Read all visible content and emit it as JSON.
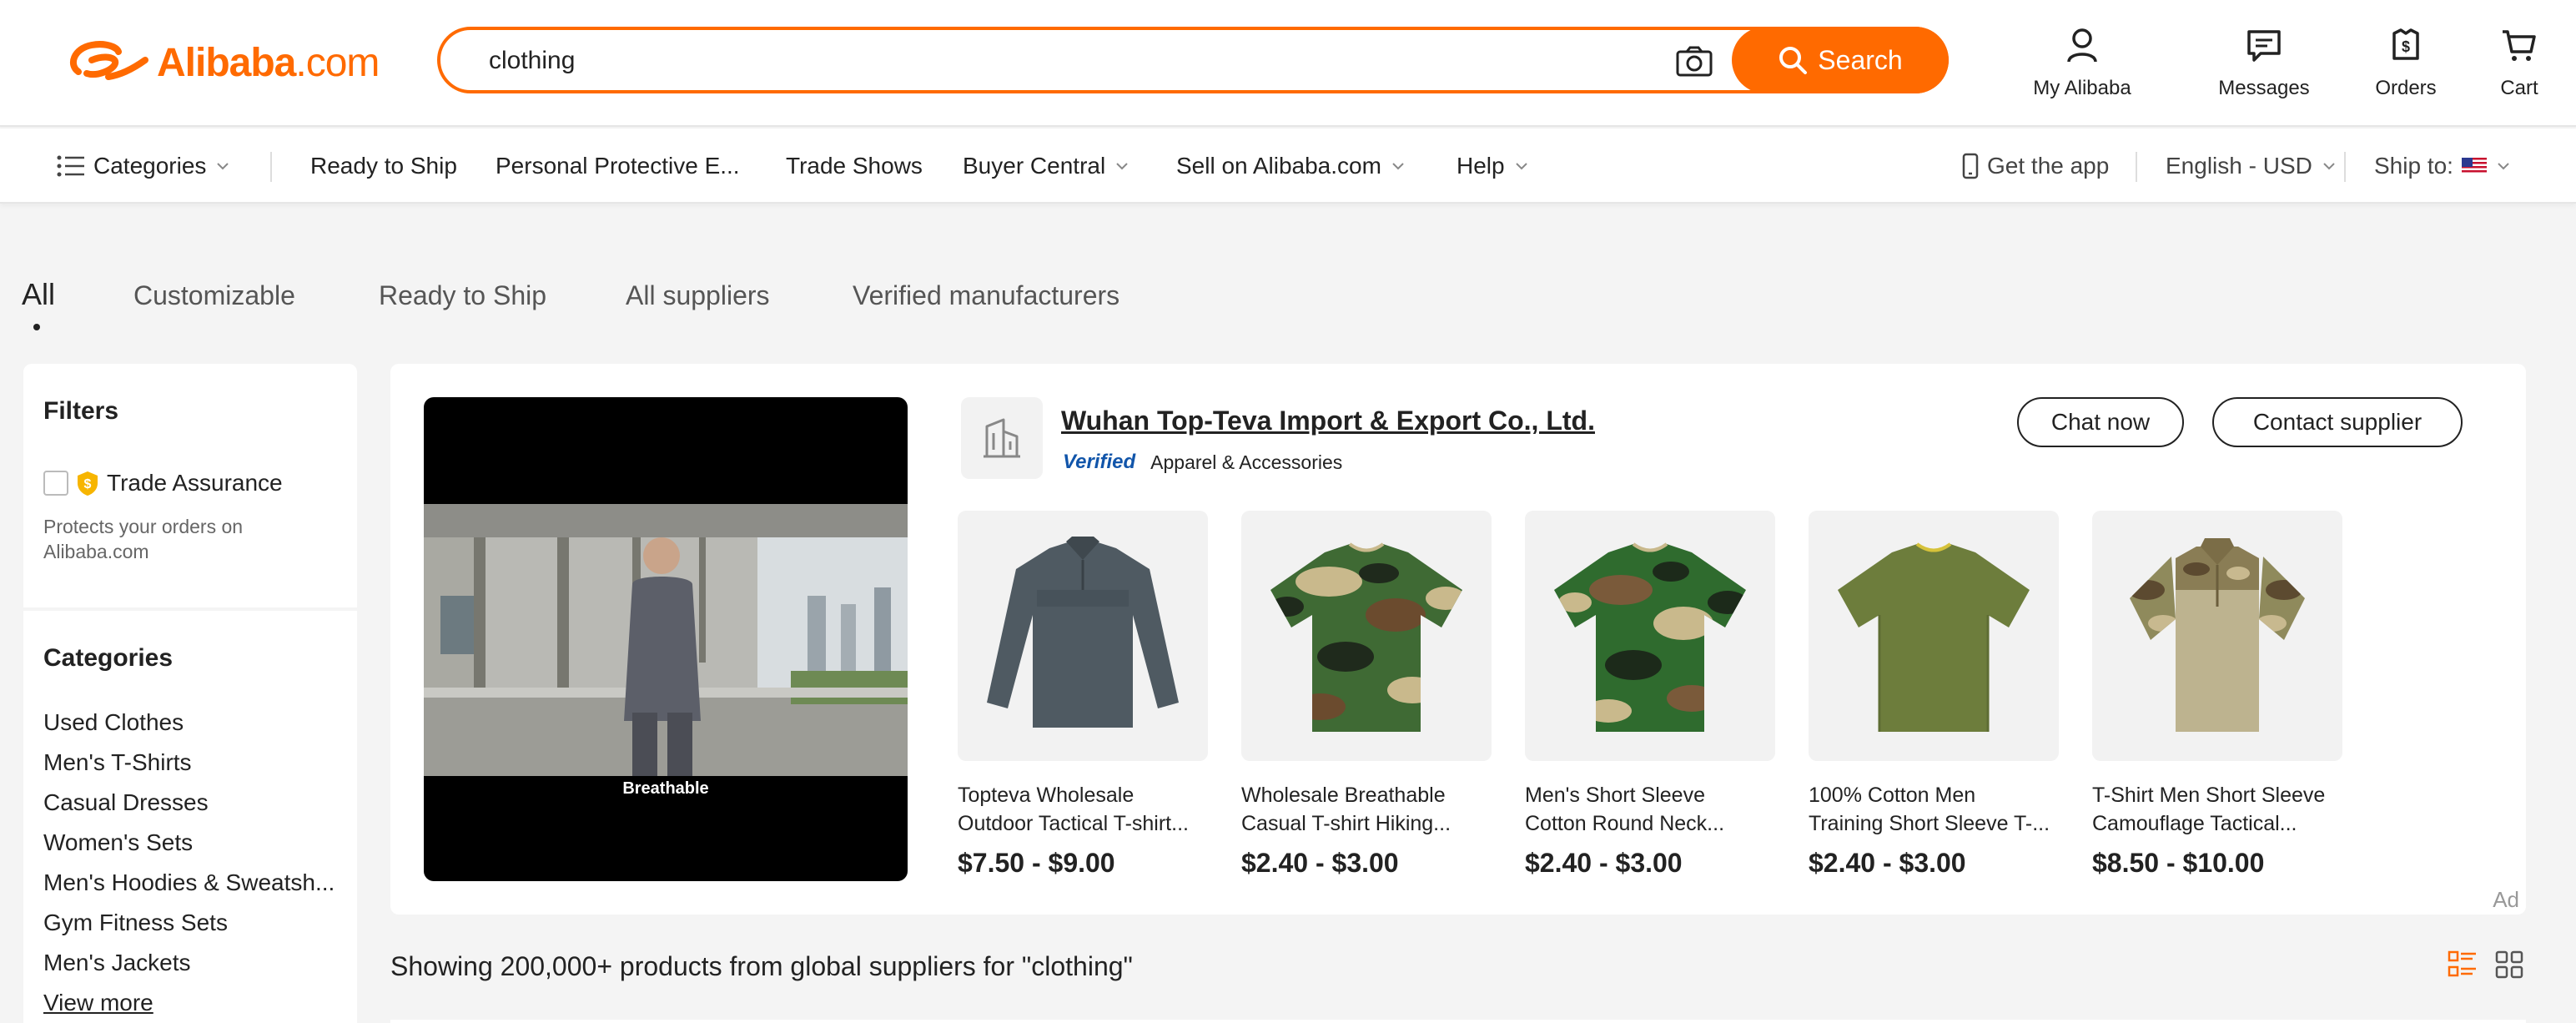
{
  "header": {
    "logo": {
      "brand": "Alibaba",
      "domain": ".com"
    },
    "search": {
      "value": "clothing",
      "button_label": "Search"
    },
    "actions": [
      {
        "label": "My Alibaba",
        "icon": "user-icon"
      },
      {
        "label": "Messages",
        "icon": "message-icon"
      },
      {
        "label": "Orders",
        "icon": "orders-icon"
      },
      {
        "label": "Cart",
        "icon": "cart-icon"
      }
    ]
  },
  "nav": {
    "categories": "Categories",
    "items": [
      "Ready to Ship",
      "Personal Protective E...",
      "Trade Shows",
      "Buyer Central",
      "Sell on Alibaba.com",
      "Help"
    ],
    "get_app": "Get the app",
    "language": "English - USD",
    "ship_to": "Ship to:"
  },
  "tabs": [
    "All",
    "Customizable",
    "Ready to Ship",
    "All suppliers",
    "Verified manufacturers"
  ],
  "filters": {
    "title": "Filters",
    "trade_assurance": "Trade Assurance",
    "trade_assurance_desc": "Protects your orders on Alibaba.com"
  },
  "categories": {
    "title": "Categories",
    "items": [
      "Used Clothes",
      "Men's T-Shirts",
      "Casual Dresses",
      "Women's Sets",
      "Men's Hoodies & Sweatsh...",
      "Gym Fitness Sets",
      "Men's Jackets"
    ],
    "view_more": "View more"
  },
  "ad": {
    "video_caption": "Breathable",
    "supplier_name": "Wuhan Top-Teva Import & Export Co., Ltd.",
    "verified": "Verified",
    "supplier_category": "Apparel & Accessories",
    "chat_label": "Chat now",
    "contact_label": "Contact supplier",
    "ad_label": "Ad",
    "products": [
      {
        "title": "Topteva Wholesale\nOutdoor Tactical T-shirt...",
        "price": "$7.50 - $9.00"
      },
      {
        "title": "Wholesale Breathable\nCasual T-shirt Hiking...",
        "price": "$2.40 - $3.00"
      },
      {
        "title": "Men's Short Sleeve\nCotton Round Neck...",
        "price": "$2.40 - $3.00"
      },
      {
        "title": "100% Cotton Men\nTraining Short Sleeve T-...",
        "price": "$2.40 - $3.00"
      },
      {
        "title": "T-Shirt Men Short Sleeve\nCamouflage Tactical...",
        "price": "$8.50 - $10.00"
      }
    ]
  },
  "results_summary": "Showing 200,000+ products from global suppliers for \"clothing\"",
  "colors": {
    "brand": "#ff6a00",
    "verified": "#1155aa"
  }
}
